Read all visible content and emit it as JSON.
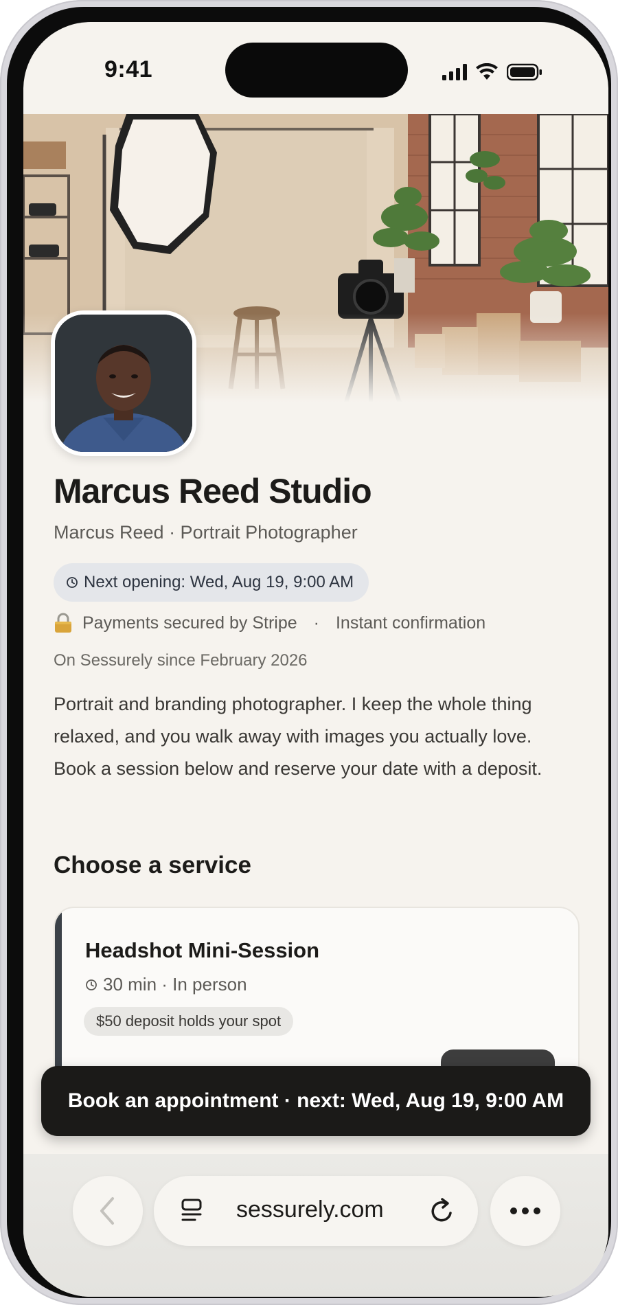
{
  "status_bar": {
    "time": "9:41",
    "icons": [
      "cellular-signal-icon",
      "wifi-icon",
      "battery-icon"
    ]
  },
  "profile": {
    "studio_name": "Marcus Reed Studio",
    "byline": "Marcus Reed · Portrait Photographer",
    "next_opening": "Next opening: Wed, Aug 19, 9:00 AM",
    "payments": "Payments secured by Stripe",
    "separator": "·",
    "confirmation": "Instant confirmation",
    "member_since": "On Sessurely since February 2026",
    "bio": "Portrait and branding photographer. I keep the whole thing relaxed, and you walk away with images you actually love. Book a session below and reserve your date with a deposit."
  },
  "services": {
    "section_title": "Choose a service",
    "items": [
      {
        "title": "Headshot Mini-Session",
        "meta": "30 min · In person",
        "deposit": "$50 deposit holds your spot"
      }
    ]
  },
  "book_bar": {
    "label": "Book an appointment · next: Wed, Aug 19, 9:00 AM"
  },
  "browser": {
    "url": "sessurely.com"
  },
  "colors": {
    "background": "#f6f3ee",
    "pill_blue_gray": "#e4e6ea",
    "dark": "#1b1a18",
    "accent_stripe": "#3b4148"
  }
}
